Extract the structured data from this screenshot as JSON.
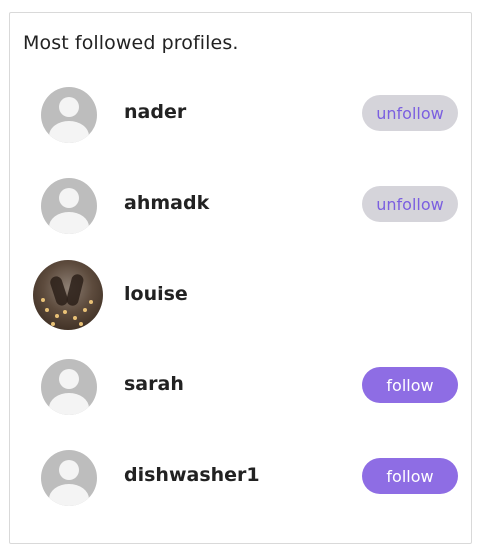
{
  "card": {
    "title": "Most followed profiles."
  },
  "profiles": [
    {
      "username": "nader",
      "avatar": "default-avatar-icon",
      "button": {
        "label": "unfollow",
        "state": "following"
      }
    },
    {
      "username": "ahmadk",
      "avatar": "default-avatar-icon",
      "button": {
        "label": "unfollow",
        "state": "following"
      }
    },
    {
      "username": "louise",
      "avatar": "photo-avatar",
      "button": null
    },
    {
      "username": "sarah",
      "avatar": "default-avatar-icon",
      "button": {
        "label": "follow",
        "state": "not-following"
      }
    },
    {
      "username": "dishwasher1",
      "avatar": "default-avatar-icon",
      "button": {
        "label": "follow",
        "state": "not-following"
      }
    }
  ],
  "colors": {
    "accent": "#8e6de4",
    "unfollow_bg": "#d5d4da",
    "unfollow_text": "#7b5fe0",
    "avatar_bg": "#bdbdbd"
  }
}
